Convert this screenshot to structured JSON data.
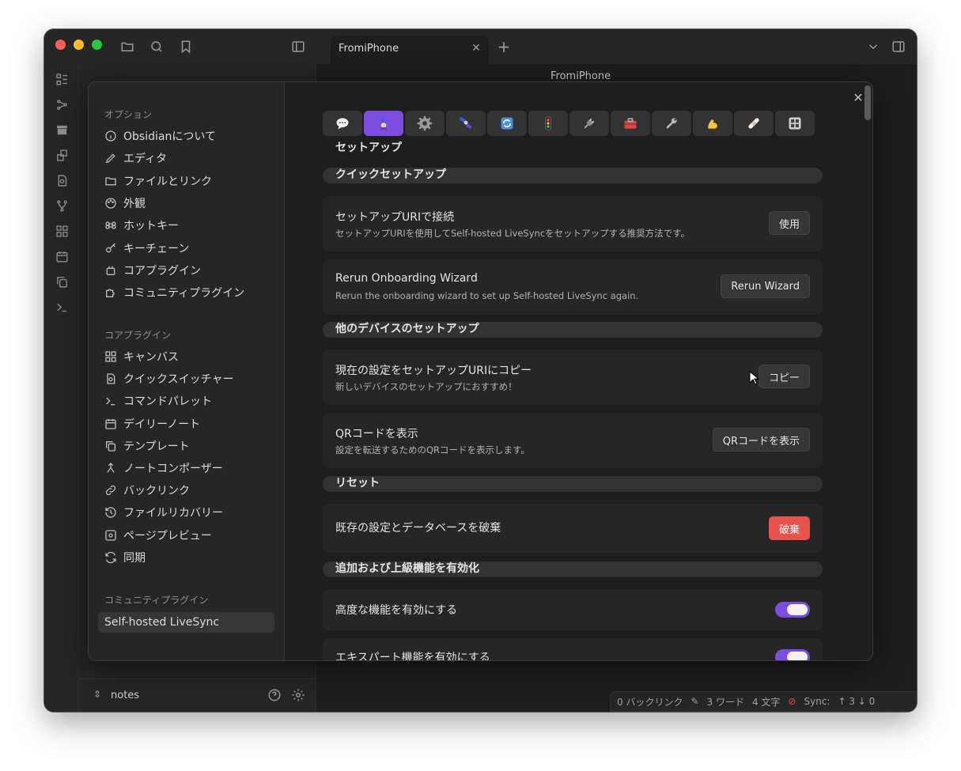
{
  "tab": {
    "title": "FromiPhone",
    "close": "✕",
    "new": "+"
  },
  "editor": {
    "title": "FromiPhone"
  },
  "explorer": {
    "vault": "notes"
  },
  "statusbar": {
    "backlinks": "0 バックリンク",
    "words": "3 ワード",
    "chars": "4 文字",
    "sync": "Sync:",
    "sync_counts": "↑ 3 ↓ 0"
  },
  "modal": {
    "close": "✕",
    "groups": {
      "options": "オプション",
      "core": "コアプラグイン",
      "community": "コミュニティプラグイン"
    },
    "options_items": [
      {
        "label": "Obsidianについて",
        "icon": "info-circle-icon"
      },
      {
        "label": "エディタ",
        "icon": "pencil-icon"
      },
      {
        "label": "ファイルとリンク",
        "icon": "folder-icon"
      },
      {
        "label": "外観",
        "icon": "palette-icon"
      },
      {
        "label": "ホットキー",
        "icon": "command-icon"
      },
      {
        "label": "キーチェーン",
        "icon": "key-icon"
      },
      {
        "label": "コアプラグイン",
        "icon": "plug-icon"
      },
      {
        "label": "コミュニティプラグイン",
        "icon": "puzzle-icon"
      }
    ],
    "core_items": [
      {
        "label": "キャンバス",
        "icon": "canvas-icon"
      },
      {
        "label": "クイックスイッチャー",
        "icon": "file-search-icon"
      },
      {
        "label": "コマンドパレット",
        "icon": "terminal-icon"
      },
      {
        "label": "デイリーノート",
        "icon": "calendar-icon"
      },
      {
        "label": "テンプレート",
        "icon": "copy-icon"
      },
      {
        "label": "ノートコンポーザー",
        "icon": "merge-icon"
      },
      {
        "label": "バックリンク",
        "icon": "link-icon"
      },
      {
        "label": "ファイルリカバリー",
        "icon": "history-icon"
      },
      {
        "label": "ページプレビュー",
        "icon": "preview-icon"
      },
      {
        "label": "同期",
        "icon": "sync-icon"
      }
    ],
    "community_items": [
      {
        "label": "Self-hosted LiveSync"
      }
    ],
    "icon_tabs": [
      "speech-bubble-icon",
      "wizard-icon",
      "gear-icon",
      "satellite-icon",
      "refresh-icon",
      "traffic-light-icon",
      "plug-icon",
      "toolbox-icon",
      "wrench-icon",
      "muscle-icon",
      "bandage-icon",
      "grid-icon"
    ],
    "page_heading": "セットアップ",
    "sections": {
      "quick": "クイックセットアップ",
      "other": "他のデバイスのセットアップ",
      "reset": "リセット",
      "advanced": "追加および上級機能を有効化"
    },
    "settings": {
      "uri": {
        "name": "セットアップURIで接続",
        "desc": "セットアップURIを使用してSelf-hosted LiveSyncをセットアップする推奨方法です。",
        "button": "使用"
      },
      "wizard": {
        "name": "Rerun Onboarding Wizard",
        "desc": "Rerun the onboarding wizard to set up Self-hosted LiveSync again.",
        "button": "Rerun Wizard"
      },
      "copy": {
        "name": "現在の設定をセットアップURIにコピー",
        "desc": "新しいデバイスのセットアップにおすすめ！",
        "button": "コピー"
      },
      "qr": {
        "name": "QRコードを表示",
        "desc": "設定を転送するためのQRコードを表示します。",
        "button": "QRコードを表示"
      },
      "discard": {
        "name": "既存の設定とデータベースを破棄",
        "button": "破棄"
      },
      "advanced": {
        "name": "高度な機能を有効にする",
        "enabled": true
      },
      "expert": {
        "name": "エキスパート機能を有効にする",
        "enabled": true
      }
    }
  },
  "colors": {
    "accent": "#7c4dde",
    "danger": "#e5534b"
  }
}
